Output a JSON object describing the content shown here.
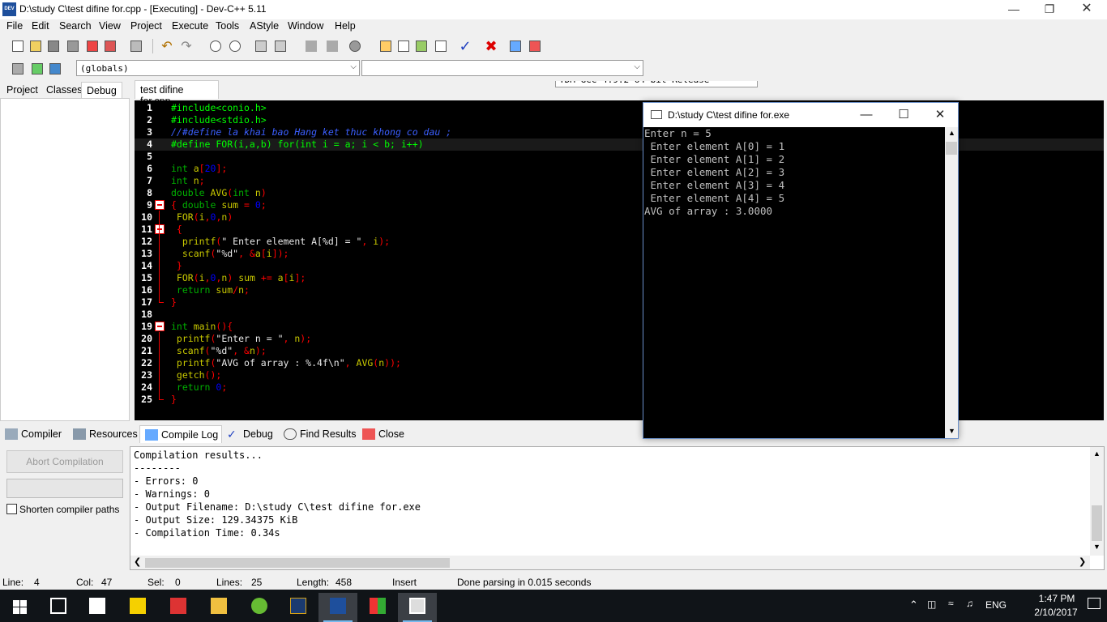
{
  "titlebar": {
    "title": "D:\\study C\\test difine for.cpp - [Executing] - Dev-C++ 5.11",
    "app_icon_text": "DEV"
  },
  "menu": [
    "File",
    "Edit",
    "Search",
    "View",
    "Project",
    "Execute",
    "Tools",
    "AStyle",
    "Window",
    "Help"
  ],
  "toolbar": {
    "compiler_select": "TDM-GCC 4.9.2 64-bit Release",
    "scope_select": "(globals)",
    "member_select": ""
  },
  "left_tabs": [
    "Project",
    "Classes",
    "Debug"
  ],
  "editor": {
    "tab": "test difine for.cpp",
    "current_line": 4,
    "lines": [
      {
        "n": "1",
        "t": [
          [
            "pp",
            "#include<conio.h>"
          ]
        ]
      },
      {
        "n": "2",
        "t": [
          [
            "pp",
            "#include<stdio.h>"
          ]
        ]
      },
      {
        "n": "3",
        "t": [
          [
            "cm",
            "//#define la khai bao Hang ket thuc khong co dau ;"
          ]
        ]
      },
      {
        "n": "4",
        "t": [
          [
            "pp",
            "#define FOR(i,a,b) for(int i = a; i < b; i++)"
          ]
        ]
      },
      {
        "n": "5",
        "t": []
      },
      {
        "n": "6",
        "t": [
          [
            "kw",
            "int "
          ],
          [
            "id",
            "a"
          ],
          [
            "sym",
            "["
          ],
          [
            "num",
            "20"
          ],
          [
            "sym",
            "];"
          ]
        ]
      },
      {
        "n": "7",
        "t": [
          [
            "kw",
            "int "
          ],
          [
            "id",
            "n"
          ],
          [
            "sym",
            ";"
          ]
        ]
      },
      {
        "n": "8",
        "t": [
          [
            "kw",
            "double "
          ],
          [
            "id",
            "AVG"
          ],
          [
            "sym",
            "("
          ],
          [
            "kw",
            "int "
          ],
          [
            "id",
            "n"
          ],
          [
            "sym",
            ")"
          ]
        ]
      },
      {
        "n": "9",
        "t": [
          [
            "sym",
            "{ "
          ],
          [
            "kw",
            "double "
          ],
          [
            "id",
            "sum"
          ],
          [
            "sym",
            " = "
          ],
          [
            "num",
            "0"
          ],
          [
            "sym",
            ";"
          ]
        ]
      },
      {
        "n": "10",
        "t": [
          [
            "id",
            " FOR"
          ],
          [
            "sym",
            "("
          ],
          [
            "id",
            "i"
          ],
          [
            "sym",
            ","
          ],
          [
            "num",
            "0"
          ],
          [
            "sym",
            ","
          ],
          [
            "id",
            "n"
          ],
          [
            "sym",
            ")"
          ]
        ]
      },
      {
        "n": "11",
        "t": [
          [
            "sym",
            " {"
          ]
        ]
      },
      {
        "n": "12",
        "t": [
          [
            "id",
            "  printf"
          ],
          [
            "sym",
            "("
          ],
          [
            "str",
            "\" Enter element A[%d] = \""
          ],
          [
            "sym",
            ", "
          ],
          [
            "id",
            "i"
          ],
          [
            "sym",
            ");"
          ]
        ]
      },
      {
        "n": "13",
        "t": [
          [
            "id",
            "  scanf"
          ],
          [
            "sym",
            "("
          ],
          [
            "str",
            "\"%d\""
          ],
          [
            "sym",
            ", &"
          ],
          [
            "id",
            "a"
          ],
          [
            "sym",
            "["
          ],
          [
            "id",
            "i"
          ],
          [
            "sym",
            "]);"
          ]
        ]
      },
      {
        "n": "14",
        "t": [
          [
            "sym",
            " }"
          ]
        ]
      },
      {
        "n": "15",
        "t": [
          [
            "id",
            " FOR"
          ],
          [
            "sym",
            "("
          ],
          [
            "id",
            "i"
          ],
          [
            "sym",
            ","
          ],
          [
            "num",
            "0"
          ],
          [
            "sym",
            ","
          ],
          [
            "id",
            "n"
          ],
          [
            "sym",
            ") "
          ],
          [
            "id",
            "sum"
          ],
          [
            "sym",
            " += "
          ],
          [
            "id",
            "a"
          ],
          [
            "sym",
            "["
          ],
          [
            "id",
            "i"
          ],
          [
            "sym",
            "];"
          ]
        ]
      },
      {
        "n": "16",
        "t": [
          [
            "kw",
            " return "
          ],
          [
            "id",
            "sum"
          ],
          [
            "sym",
            "/"
          ],
          [
            "id",
            "n"
          ],
          [
            "sym",
            ";"
          ]
        ]
      },
      {
        "n": "17",
        "t": [
          [
            "sym",
            "}"
          ]
        ]
      },
      {
        "n": "18",
        "t": []
      },
      {
        "n": "19",
        "t": [
          [
            "kw",
            "int "
          ],
          [
            "id",
            "main"
          ],
          [
            "sym",
            "(){"
          ]
        ]
      },
      {
        "n": "20",
        "t": [
          [
            "id",
            " printf"
          ],
          [
            "sym",
            "("
          ],
          [
            "str",
            "\"Enter n = \""
          ],
          [
            "sym",
            ", "
          ],
          [
            "id",
            "n"
          ],
          [
            "sym",
            ");"
          ]
        ]
      },
      {
        "n": "21",
        "t": [
          [
            "id",
            " scanf"
          ],
          [
            "sym",
            "("
          ],
          [
            "str",
            "\"%d\""
          ],
          [
            "sym",
            ", &"
          ],
          [
            "id",
            "n"
          ],
          [
            "sym",
            ");"
          ]
        ]
      },
      {
        "n": "22",
        "t": [
          [
            "id",
            " printf"
          ],
          [
            "sym",
            "("
          ],
          [
            "str",
            "\"AVG of array : %.4f\\n\""
          ],
          [
            "sym",
            ", "
          ],
          [
            "id",
            "AVG"
          ],
          [
            "sym",
            "("
          ],
          [
            "id",
            "n"
          ],
          [
            "sym",
            "));"
          ]
        ]
      },
      {
        "n": "23",
        "t": [
          [
            "id",
            " getch"
          ],
          [
            "sym",
            "();"
          ]
        ]
      },
      {
        "n": "24",
        "t": [
          [
            "kw",
            " return "
          ],
          [
            "num",
            "0"
          ],
          [
            "sym",
            ";"
          ]
        ]
      },
      {
        "n": "25",
        "t": [
          [
            "sym",
            "}"
          ]
        ]
      }
    ]
  },
  "console": {
    "title": "D:\\study C\\test difine for.exe",
    "output": "Enter n = 5\n Enter element A[0] = 1\n Enter element A[1] = 2\n Enter element A[2] = 3\n Enter element A[3] = 4\n Enter element A[4] = 5\nAVG of array : 3.0000"
  },
  "bottom_tabs": [
    "Compiler",
    "Resources",
    "Compile Log",
    "Debug",
    "Find Results",
    "Close"
  ],
  "compile": {
    "abort_label": "Abort Compilation",
    "shorten_label": "Shorten compiler paths",
    "log": "Compilation results...\n--------\n- Errors: 0\n- Warnings: 0\n- Output Filename: D:\\study C\\test difine for.exe\n- Output Size: 129.34375 KiB\n- Compilation Time: 0.34s"
  },
  "status": {
    "line_label": "Line:",
    "line": "4",
    "col_label": "Col:",
    "col": "47",
    "sel_label": "Sel:",
    "sel": "0",
    "lines_label": "Lines:",
    "lines": "25",
    "length_label": "Length:",
    "length": "458",
    "mode": "Insert",
    "message": "Done parsing in 0.015 seconds"
  },
  "taskbar": {
    "lang": "ENG",
    "time": "1:47 PM",
    "date": "2/10/2017"
  }
}
